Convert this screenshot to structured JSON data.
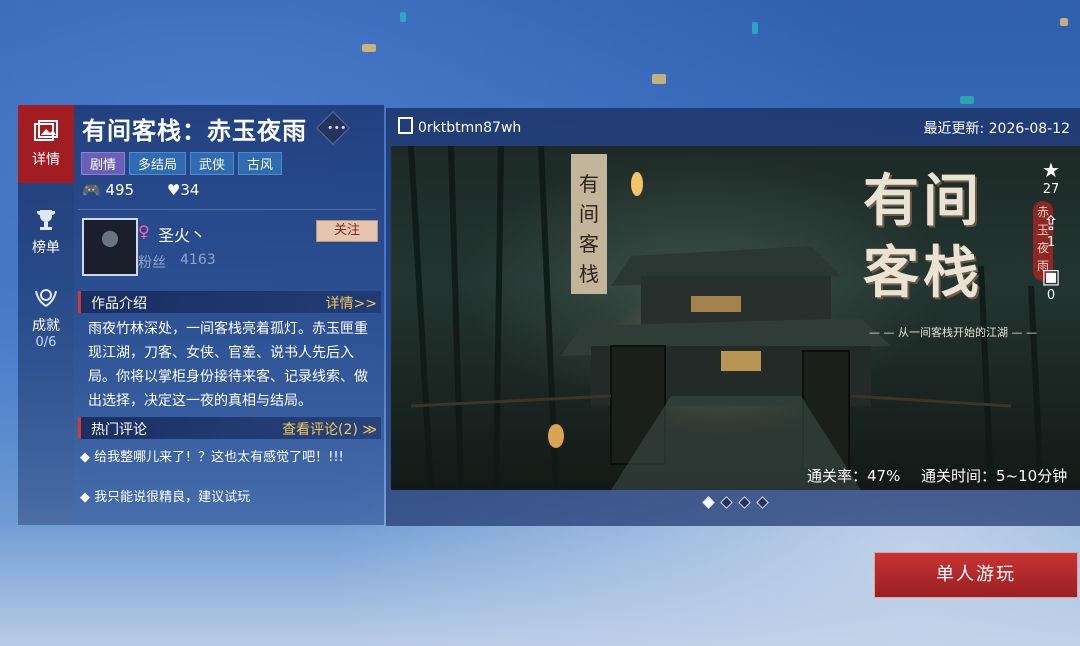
{
  "nav": {
    "items": [
      {
        "label": "详情",
        "sub": ""
      },
      {
        "label": "榜单",
        "sub": ""
      },
      {
        "label": "成就",
        "sub": "0/6"
      }
    ]
  },
  "game": {
    "title": "有间客栈：赤玉夜雨",
    "tags": [
      "剧情",
      "多结局",
      "武侠",
      "古风"
    ],
    "plays": "495",
    "likes": "34"
  },
  "author": {
    "name": "圣火丶",
    "follow_label": "关注",
    "fans_label": "粉丝",
    "fans": "4163"
  },
  "intro": {
    "heading": "作品介绍",
    "more": "详情>>",
    "text": "雨夜竹林深处，一间客栈亮着孤灯。赤玉匣重现江湖，刀客、女侠、官差、说书人先后入局。你将以掌柜身份接待来客、记录线索、做出选择，决定这一夜的真相与结局。"
  },
  "comments": {
    "heading": "热门评论",
    "more": "查看评论(2) ≫",
    "items": [
      "◆ 给我整哪儿来了！？这也太有感觉了吧！!!!",
      "◆ 我只能说很精良，建议试玩"
    ]
  },
  "preview": {
    "id": "0rktbtmn87wh",
    "updated": "最近更新: 2026-08-12",
    "logo_line1": "有间",
    "logo_line2": "客栈",
    "logo_sub": "— — 从一间客栈开始的江湖 — —",
    "seal": "赤玉夜雨",
    "favorites": "27",
    "shares": "1",
    "gifts": "0",
    "clear_rate": "通关率：47%",
    "clear_time": "通关时间：5~10分钟",
    "page_dots": 4,
    "active_dot": 0
  },
  "actions": {
    "play_label": "单人游玩"
  },
  "colors": {
    "accent_red": "#a11d22",
    "gold": "#f4c657"
  }
}
